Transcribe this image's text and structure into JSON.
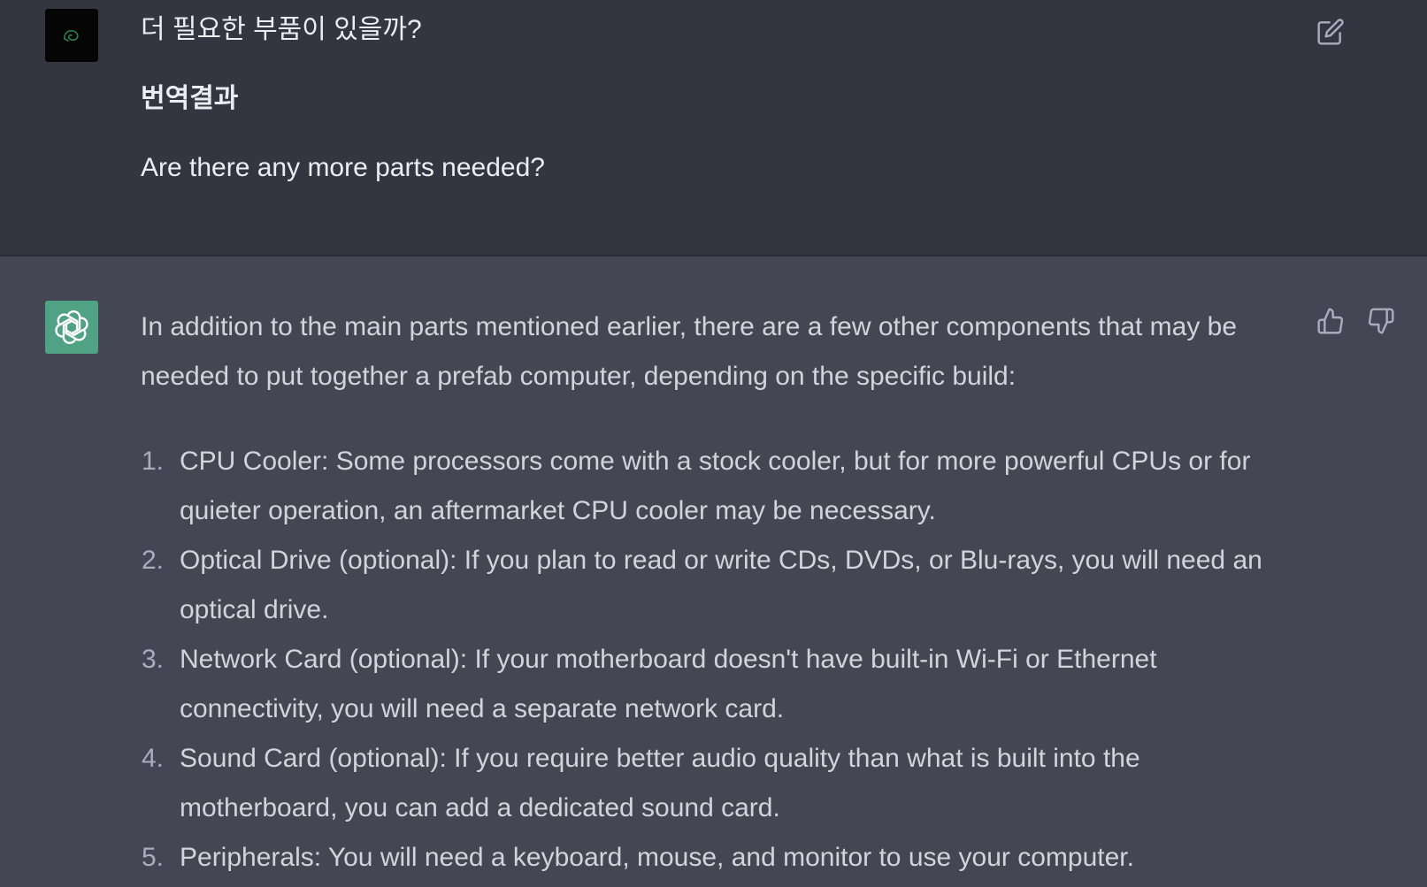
{
  "user_message": {
    "question": "더 필요한 부품이 있을까?",
    "heading": "번역결과",
    "translation": "Are there any more parts needed?",
    "avatar_icon": "user-avatar-icon",
    "edit_icon": "edit-icon"
  },
  "assistant_message": {
    "avatar_icon": "openai-logo-icon",
    "intro": "In addition to the main parts mentioned earlier, there are a few other components that may be needed to put together a prefab computer, depending on the specific build:",
    "items": [
      {
        "num": "1.",
        "text": "CPU Cooler: Some processors come with a stock cooler, but for more powerful CPUs or for quieter operation, an aftermarket CPU cooler may be necessary."
      },
      {
        "num": "2.",
        "text": "Optical Drive (optional): If you plan to read or write CDs, DVDs, or Blu-rays, you will need an optical drive."
      },
      {
        "num": "3.",
        "text": "Network Card (optional): If your motherboard doesn't have built-in Wi-Fi or Ethernet connectivity, you will need a separate network card."
      },
      {
        "num": "4.",
        "text": "Sound Card (optional): If you require better audio quality than what is built into the motherboard, you can add a dedicated sound card."
      },
      {
        "num": "5.",
        "text": "Peripherals: You will need a keyboard, mouse, and monitor to use your computer."
      }
    ],
    "thumb_up_icon": "thumbs-up-icon",
    "thumb_down_icon": "thumbs-down-icon"
  },
  "colors": {
    "user_bg": "#343541",
    "assistant_bg": "#444654",
    "bot_avatar_bg": "#4fa283",
    "text": "#d1d5db"
  }
}
